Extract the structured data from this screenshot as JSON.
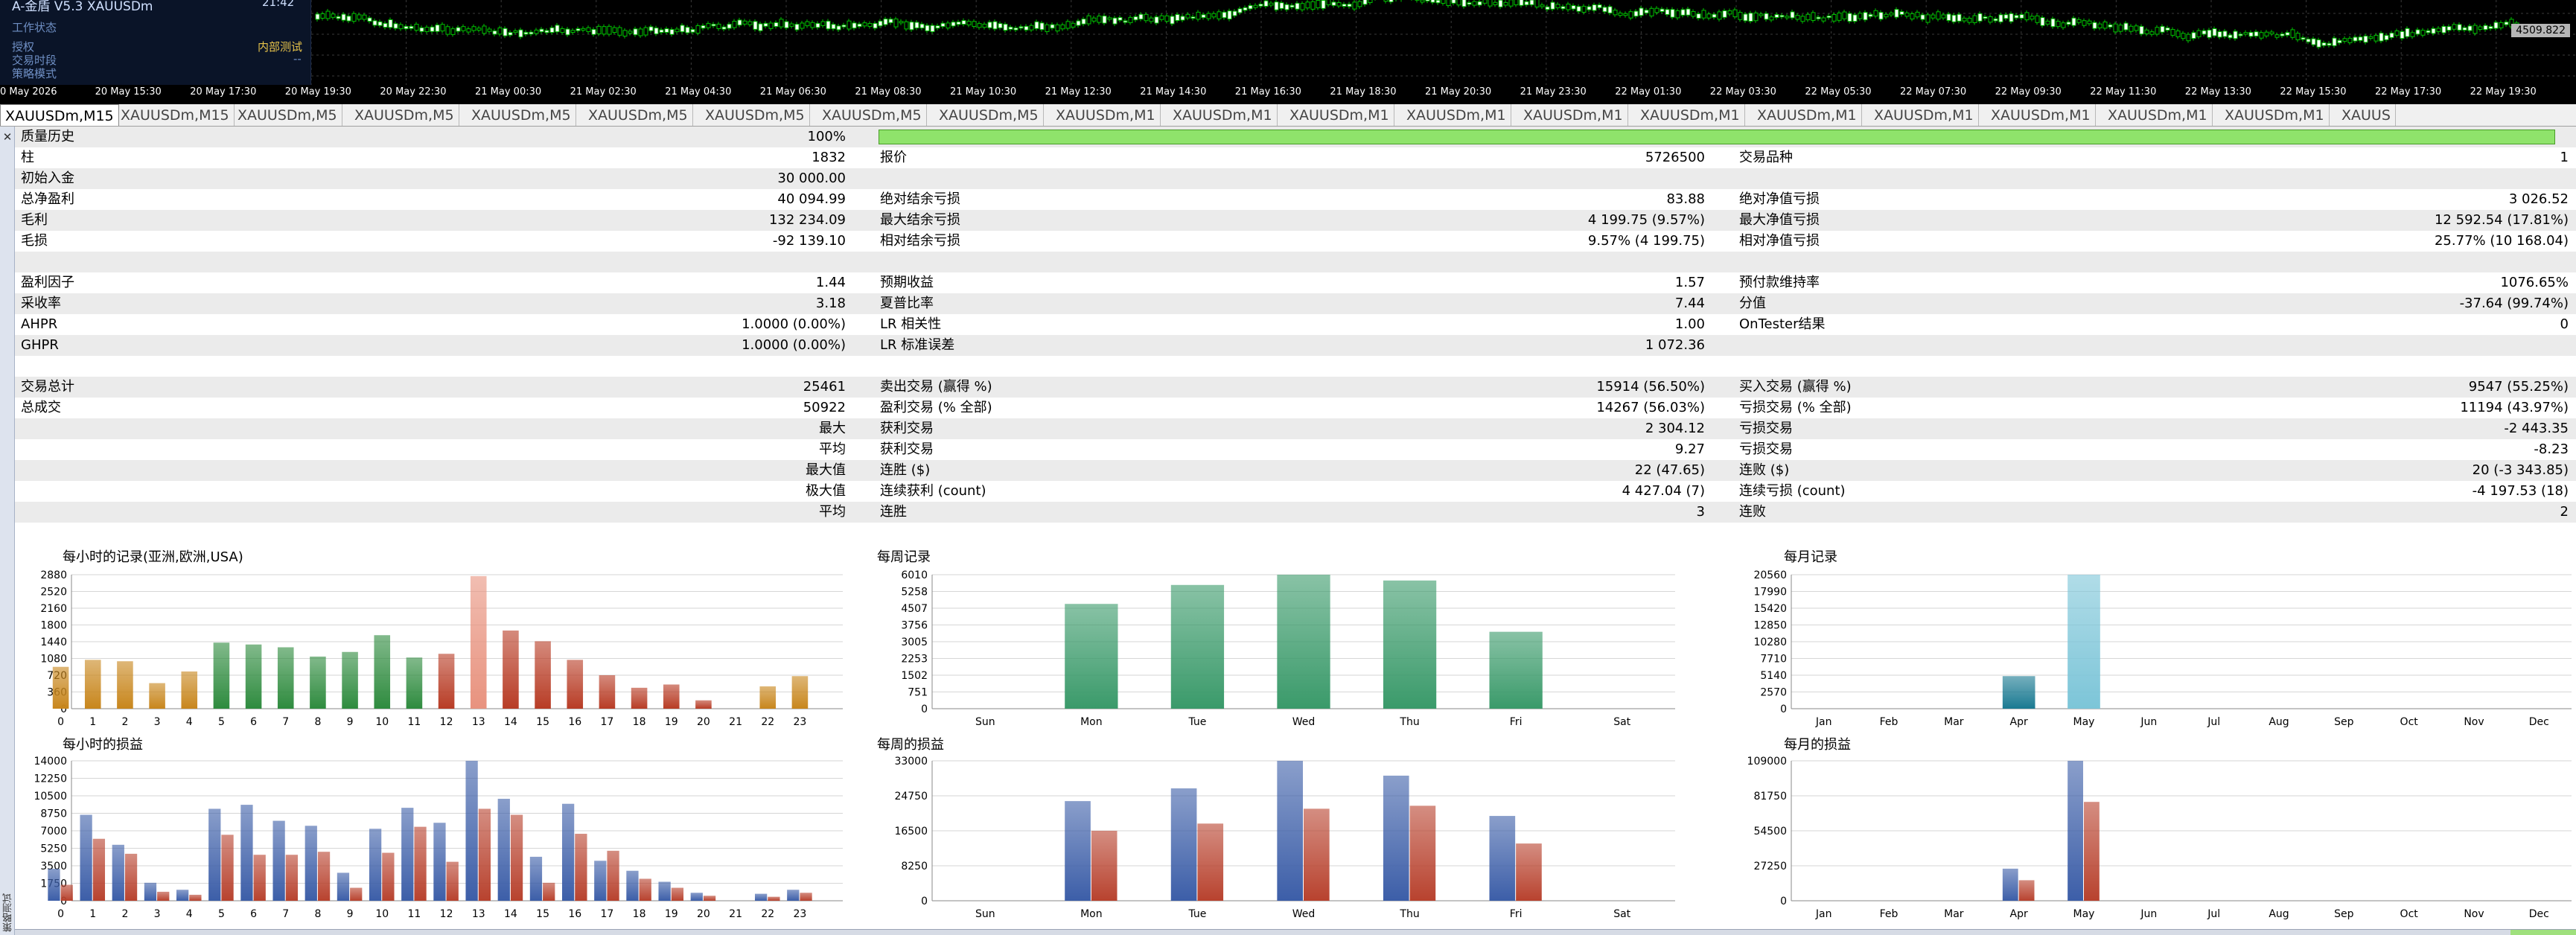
{
  "ea_panel": {
    "title": "A-金盾 V5.3  XAUUSDm",
    "status_title": "工作状态",
    "lines": [
      "授权",
      "交易时段",
      "策略模式"
    ],
    "right_values": [
      "内部测试",
      "--"
    ],
    "clock": "21:42"
  },
  "price_label": "4509.822",
  "time_axis": [
    "0 May 2026",
    "20 May 15:30",
    "20 May 17:30",
    "20 May 19:30",
    "20 May 22:30",
    "21 May 00:30",
    "21 May 02:30",
    "21 May 04:30",
    "21 May 06:30",
    "21 May 08:30",
    "21 May 10:30",
    "21 May 12:30",
    "21 May 14:30",
    "21 May 16:30",
    "21 May 18:30",
    "21 May 20:30",
    "21 May 23:30",
    "22 May 01:30",
    "22 May 03:30",
    "22 May 05:30",
    "22 May 07:30",
    "22 May 09:30",
    "22 May 11:30",
    "22 May 13:30",
    "22 May 15:30",
    "22 May 17:30",
    "22 May 19:30"
  ],
  "tabs": [
    "XAUUSDm,M15",
    "XAUUSDm,M15",
    "XAUUSDm,M5",
    "XAUUSDm,M5",
    "XAUUSDm,M5",
    "XAUUSDm,M5",
    "XAUUSDm,M5",
    "XAUUSDm,M5",
    "XAUUSDm,M5",
    "XAUUSDm,M1",
    "XAUUSDm,M1",
    "XAUUSDm,M1",
    "XAUUSDm,M1",
    "XAUUSDm,M1",
    "XAUUSDm,M1",
    "XAUUSDm,M1",
    "XAUUSDm,M1",
    "XAUUSDm,M1",
    "XAUUSDm,M1",
    "XAUUSDm,M1",
    "XAUUS"
  ],
  "side_label": "策略测试",
  "quality_history": {
    "label": "质量历史",
    "value": "100%",
    "fill_fraction": 1.0
  },
  "rows": [
    {
      "shade": false,
      "l1": "柱",
      "v1": "1832",
      "l2": "报价",
      "v2": "5726500",
      "l3": "交易品种",
      "v3": "1"
    },
    {
      "shade": true,
      "l1": "初始入金",
      "v1": "30 000.00",
      "l2": "",
      "v2": "",
      "l3": "",
      "v3": ""
    },
    {
      "shade": false,
      "l1": "总净盈利",
      "v1": "40 094.99",
      "l2": "绝对结余亏损",
      "v2": "83.88",
      "l3": "绝对净值亏损",
      "v3": "3 026.52"
    },
    {
      "shade": true,
      "l1": "毛利",
      "v1": "132 234.09",
      "l2": "最大结余亏损",
      "v2": "4 199.75 (9.57%)",
      "l3": "最大净值亏损",
      "v3": "12 592.54 (17.81%)"
    },
    {
      "shade": false,
      "l1": "毛损",
      "v1": "-92 139.10",
      "l2": "相对结余亏损",
      "v2": "9.57% (4 199.75)",
      "l3": "相对净值亏损",
      "v3": "25.77% (10 168.04)"
    },
    {
      "shade": true,
      "l1": "",
      "v1": "",
      "l2": "",
      "v2": "",
      "l3": "",
      "v3": ""
    },
    {
      "shade": false,
      "l1": "盈利因子",
      "v1": "1.44",
      "l2": "预期收益",
      "v2": "1.57",
      "l3": "预付款维持率",
      "v3": "1076.65%"
    },
    {
      "shade": true,
      "l1": "采收率",
      "v1": "3.18",
      "l2": "夏普比率",
      "v2": "7.44",
      "l3": "分值",
      "v3": "-37.64 (99.74%)"
    },
    {
      "shade": false,
      "l1": "AHPR",
      "v1": "1.0000 (0.00%)",
      "l2": "LR 相关性",
      "v2": "1.00",
      "l3": "OnTester结果",
      "v3": "0"
    },
    {
      "shade": true,
      "l1": "GHPR",
      "v1": "1.0000 (0.00%)",
      "l2": "LR 标准误差",
      "v2": "1 072.36",
      "l3": "",
      "v3": ""
    },
    {
      "shade": false,
      "l1": "",
      "v1": "",
      "l2": "",
      "v2": "",
      "l3": "",
      "v3": ""
    },
    {
      "shade": true,
      "l1": "交易总计",
      "v1": "25461",
      "l2": "卖出交易 (赢得 %)",
      "v2": "15914 (56.50%)",
      "l3": "买入交易 (赢得 %)",
      "v3": "9547 (55.25%)"
    },
    {
      "shade": false,
      "l1": "总成交",
      "v1": "50922",
      "l2": "盈利交易 (% 全部)",
      "v2": "14267 (56.03%)",
      "l3": "亏损交易 (% 全部)",
      "v3": "11194 (43.97%)"
    },
    {
      "shade": true,
      "l1": "",
      "r1": "最大",
      "l2": "获利交易",
      "v2": "2 304.12",
      "l3": "亏损交易",
      "v3": "-2 443.35"
    },
    {
      "shade": false,
      "l1": "",
      "r1": "平均",
      "l2": "获利交易",
      "v2": "9.27",
      "l3": "亏损交易",
      "v3": "-8.23"
    },
    {
      "shade": true,
      "l1": "",
      "r1": "最大值",
      "l2": "连胜 ($)",
      "v2": "22 (47.65)",
      "l3": "连败 ($)",
      "v3": "20 (-3 343.85)"
    },
    {
      "shade": false,
      "l1": "",
      "r1": "极大值",
      "l2": "连续获利 (count)",
      "v2": "4 427.04 (7)",
      "l3": "连续亏损 (count)",
      "v3": "-4 197.53 (18)"
    },
    {
      "shade": true,
      "l1": "",
      "r1": "平均",
      "l2": "连胜",
      "v2": "3",
      "l3": "连败",
      "v3": "2"
    }
  ],
  "colors": {
    "hourly_green": "#2e8b3e",
    "hourly_gold": "#c8861c",
    "hourly_red": "#b83c25",
    "hourly_peak": "#e8927e",
    "weekly_green": "#3a9a6a",
    "monthly_teal": "#1a7a92",
    "monthly_light": "#7cc5d8",
    "profit_blue": "#3c5ea8",
    "loss_red": "#b8422e",
    "quality_green": "#8fe36b"
  },
  "chart_data": [
    {
      "type": "bar",
      "title": "每小时的记录(亚洲,欧洲,USA)",
      "categories": [
        "0",
        "1",
        "2",
        "3",
        "4",
        "5",
        "6",
        "7",
        "8",
        "9",
        "10",
        "11",
        "12",
        "13",
        "14",
        "15",
        "16",
        "17",
        "18",
        "19",
        "20",
        "21",
        "22",
        "23"
      ],
      "values": [
        900,
        1050,
        1020,
        550,
        800,
        1420,
        1380,
        1320,
        1120,
        1220,
        1580,
        1100,
        1180,
        2850,
        1680,
        1450,
        1050,
        720,
        450,
        520,
        180,
        0,
        480,
        700
      ],
      "bar_colors": [
        "#c8861c",
        "#c8861c",
        "#c8861c",
        "#c8861c",
        "#c8861c",
        "#2e8b3e",
        "#2e8b3e",
        "#2e8b3e",
        "#2e8b3e",
        "#2e8b3e",
        "#2e8b3e",
        "#2e8b3e",
        "#b83c25",
        "#e8927e",
        "#b83c25",
        "#b83c25",
        "#b83c25",
        "#b83c25",
        "#b83c25",
        "#b83c25",
        "#b83c25",
        "#b83c25",
        "#c8861c",
        "#c8861c"
      ],
      "yticks": [
        0,
        360,
        720,
        1080,
        1440,
        1800,
        2160,
        2520,
        2880
      ],
      "ylim": [
        0,
        2880
      ]
    },
    {
      "type": "bar",
      "title": "每周记录",
      "categories": [
        "Sun",
        "Mon",
        "Tue",
        "Wed",
        "Thu",
        "Fri",
        "Sat"
      ],
      "values": [
        0,
        4700,
        5550,
        6010,
        5750,
        3450,
        0
      ],
      "bar_colors": [
        "#3a9a6a",
        "#3a9a6a",
        "#3a9a6a",
        "#3a9a6a",
        "#3a9a6a",
        "#3a9a6a",
        "#3a9a6a"
      ],
      "yticks": [
        0,
        751,
        1502,
        2253,
        3005,
        3756,
        4507,
        5258,
        6010
      ],
      "ylim": [
        0,
        6010
      ]
    },
    {
      "type": "bar",
      "title": "每月记录",
      "categories": [
        "Jan",
        "Feb",
        "Mar",
        "Apr",
        "May",
        "Jun",
        "Jul",
        "Aug",
        "Sep",
        "Oct",
        "Nov",
        "Dec"
      ],
      "values": [
        0,
        0,
        0,
        5000,
        20560,
        0,
        0,
        0,
        0,
        0,
        0,
        0
      ],
      "bar_colors": [
        "#1a7a92",
        "#1a7a92",
        "#1a7a92",
        "#1a7a92",
        "#7cc5d8",
        "#1a7a92",
        "#1a7a92",
        "#1a7a92",
        "#1a7a92",
        "#1a7a92",
        "#1a7a92",
        "#1a7a92"
      ],
      "yticks": [
        0,
        2570,
        5140,
        7710,
        10280,
        12850,
        15420,
        17990,
        20560
      ],
      "ylim": [
        0,
        20560
      ]
    },
    {
      "type": "bar",
      "title": "每小时的损益",
      "categories": [
        "0",
        "1",
        "2",
        "3",
        "4",
        "5",
        "6",
        "7",
        "8",
        "9",
        "10",
        "11",
        "12",
        "13",
        "14",
        "15",
        "16",
        "17",
        "18",
        "19",
        "20",
        "21",
        "22",
        "23"
      ],
      "series": [
        {
          "values": [
            3200,
            8600,
            5600,
            1800,
            1100,
            9200,
            9600,
            8000,
            7500,
            2800,
            7200,
            9300,
            7800,
            14000,
            10200,
            4400,
            9700,
            4000,
            3000,
            1900,
            800,
            0,
            700,
            1100
          ]
        },
        {
          "values": [
            1600,
            6200,
            4700,
            900,
            600,
            6600,
            4600,
            4600,
            4900,
            1300,
            4800,
            7400,
            3900,
            9200,
            8600,
            1800,
            6700,
            5000,
            2200,
            1300,
            500,
            0,
            400,
            800
          ]
        }
      ],
      "series_colors": [
        "#3c5ea8",
        "#b8422e"
      ],
      "yticks": [
        0,
        1750,
        3500,
        5250,
        7000,
        8750,
        10500,
        12250,
        14000
      ],
      "ylim": [
        0,
        14000
      ]
    },
    {
      "type": "bar",
      "title": "每周的损益",
      "categories": [
        "Sun",
        "Mon",
        "Tue",
        "Wed",
        "Thu",
        "Fri",
        "Sat"
      ],
      "series": [
        {
          "values": [
            0,
            23500,
            26500,
            33000,
            29500,
            20000,
            0
          ]
        },
        {
          "values": [
            0,
            16500,
            18200,
            21700,
            22400,
            13500,
            0
          ]
        }
      ],
      "series_colors": [
        "#3c5ea8",
        "#b8422e"
      ],
      "yticks": [
        0,
        8250,
        16500,
        24750,
        33000
      ],
      "ylim": [
        0,
        33000
      ]
    },
    {
      "type": "bar",
      "title": "每月的损益",
      "categories": [
        "Jan",
        "Feb",
        "Mar",
        "Apr",
        "May",
        "Jun",
        "Jul",
        "Aug",
        "Sep",
        "Oct",
        "Nov",
        "Dec"
      ],
      "series": [
        {
          "values": [
            0,
            0,
            0,
            25000,
            109000,
            0,
            0,
            0,
            0,
            0,
            0,
            0
          ]
        },
        {
          "values": [
            0,
            0,
            0,
            16000,
            77000,
            0,
            0,
            0,
            0,
            0,
            0,
            0
          ]
        }
      ],
      "series_colors": [
        "#3c5ea8",
        "#b8422e"
      ],
      "yticks": [
        0,
        27250,
        54500,
        81750,
        109000
      ],
      "ylim": [
        0,
        109000
      ]
    }
  ]
}
